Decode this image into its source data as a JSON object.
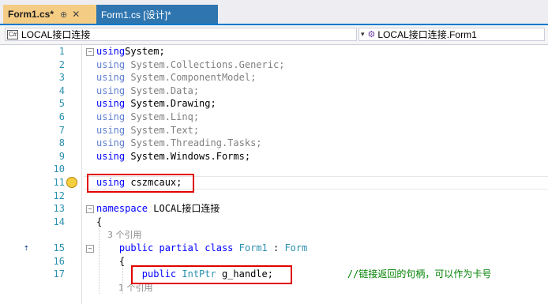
{
  "tabs": [
    {
      "label": "Form1.cs*",
      "pin": "⊕",
      "close": "✕",
      "active": true
    },
    {
      "label": "Form1.cs [设计]*",
      "active": false
    }
  ],
  "navbar": {
    "project": "LOCAL接口连接",
    "member": "LOCAL接口连接.Form1"
  },
  "editor": {
    "lines": [
      {
        "n": "1",
        "segs": [
          [
            "kw",
            "using"
          ],
          [
            "",
            "System;"
          ]
        ]
      },
      {
        "n": "2",
        "segs": [
          [
            "kwg",
            "using"
          ],
          [
            "gray",
            " System.Collections.Generic;"
          ]
        ]
      },
      {
        "n": "3",
        "segs": [
          [
            "kwg",
            "using"
          ],
          [
            "gray",
            " System.ComponentModel;"
          ]
        ]
      },
      {
        "n": "4",
        "segs": [
          [
            "kwg",
            "using"
          ],
          [
            "gray",
            " System.Data;"
          ]
        ]
      },
      {
        "n": "5",
        "segs": [
          [
            "kw",
            "using"
          ],
          [
            "",
            " System.Drawing;"
          ]
        ]
      },
      {
        "n": "6",
        "segs": [
          [
            "kwg",
            "using"
          ],
          [
            "gray",
            " System.Linq;"
          ]
        ]
      },
      {
        "n": "7",
        "segs": [
          [
            "kwg",
            "using"
          ],
          [
            "gray",
            " System.Text;"
          ]
        ]
      },
      {
        "n": "8",
        "segs": [
          [
            "kwg",
            "using"
          ],
          [
            "gray",
            " System.Threading.Tasks;"
          ]
        ]
      },
      {
        "n": "9",
        "segs": [
          [
            "kw",
            "using"
          ],
          [
            "",
            " System.Windows.Forms;"
          ]
        ]
      },
      {
        "n": "10",
        "segs": []
      },
      {
        "n": "11",
        "segs": [
          [
            "kw",
            "using"
          ],
          [
            "",
            " cszmcaux;"
          ]
        ]
      },
      {
        "n": "12",
        "segs": []
      },
      {
        "n": "13",
        "segs": [
          [
            "kw",
            "namespace"
          ],
          [
            "",
            " LOCAL接口连接"
          ]
        ]
      },
      {
        "n": "14",
        "segs": [
          [
            "",
            "{"
          ]
        ]
      },
      {
        "n": "",
        "segs": [
          [
            "ref",
            "    3 个引用"
          ]
        ]
      },
      {
        "n": "15",
        "segs": [
          [
            "kw",
            "    public partial class"
          ],
          [
            "ty",
            " Form1"
          ],
          [
            "",
            " : "
          ],
          [
            "ty",
            "Form"
          ]
        ]
      },
      {
        "n": "16",
        "segs": [
          [
            "",
            "    {"
          ]
        ]
      },
      {
        "n": "17",
        "segs": [
          [
            "kw",
            "        public"
          ],
          [
            "ty",
            " IntPtr"
          ],
          [
            "",
            " g_handle;"
          ],
          [
            "cm",
            "             //链接返回的句柄，可以作为卡号"
          ]
        ]
      },
      {
        "n": "",
        "segs": [
          [
            "ref",
            "        1 个引用"
          ]
        ]
      }
    ]
  },
  "colors": {
    "keyword": "#0000ff",
    "type": "#2b91af",
    "comment": "#008000",
    "highlight": "#e00000"
  }
}
